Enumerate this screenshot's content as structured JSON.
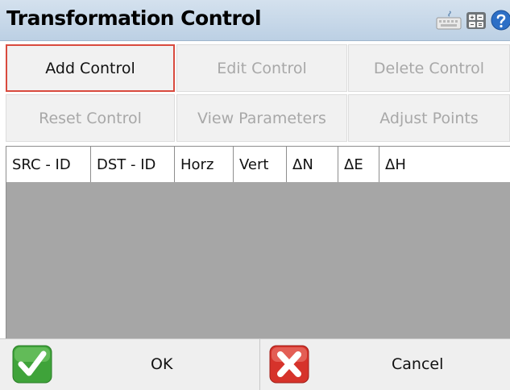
{
  "window": {
    "title": "Transformation Control"
  },
  "title_icons": [
    "keyboard-icon",
    "calculator-icon",
    "help-icon"
  ],
  "toolbar": {
    "add_control": "Add Control",
    "edit_control": "Edit Control",
    "delete_control": "Delete Control",
    "reset_control": "Reset Control",
    "view_parameters": "View Parameters",
    "adjust_points": "Adjust Points"
  },
  "table": {
    "columns": [
      "SRC - ID",
      "DST - ID",
      "Horz",
      "Vert",
      "ΔN",
      "ΔE",
      "ΔH"
    ],
    "rows": []
  },
  "footer": {
    "ok": "OK",
    "cancel": "Cancel"
  },
  "colors": {
    "accent": "#d94a3e",
    "title_bar": "#c8d8e8",
    "empty_grid": "#a6a6a6",
    "ok_green": "#3fa33a",
    "cancel_red": "#d6332b"
  }
}
